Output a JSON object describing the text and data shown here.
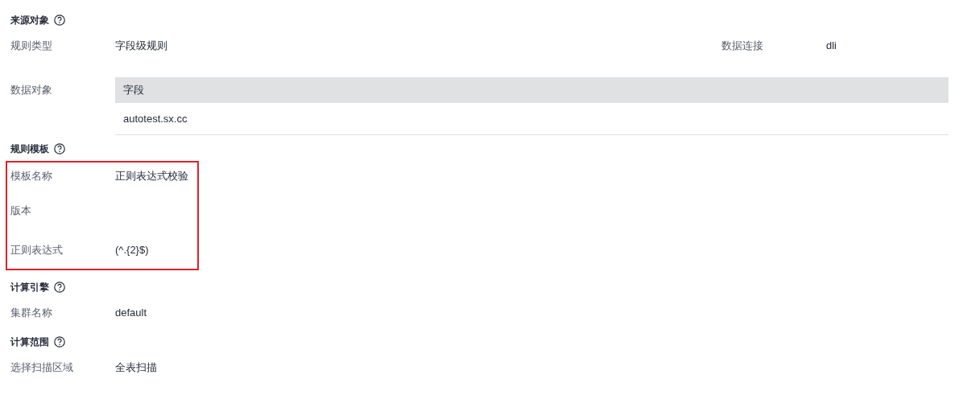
{
  "sections": [
    {
      "title": "来源对象",
      "highlighted": false,
      "rows": [
        {
          "kind": "pair",
          "label": "规则类型",
          "value": "字段级规则",
          "extra_label": "数据连接",
          "extra_value": "dli"
        },
        {
          "kind": "table",
          "label": "数据对象",
          "column": "字段",
          "cells": [
            "autotest.sx.cc"
          ]
        }
      ]
    },
    {
      "title": "规则模板",
      "highlighted": true,
      "rows": [
        {
          "kind": "pair",
          "label": "模板名称",
          "value": "正则表达式校验"
        },
        {
          "kind": "pair",
          "label": "版本"
        },
        {
          "kind": "pair",
          "label": "正则表达式",
          "value": "(^.{2}$)"
        }
      ]
    },
    {
      "title": "计算引擎",
      "highlighted": false,
      "rows": [
        {
          "kind": "pair",
          "label": "集群名称",
          "value": "default"
        }
      ]
    },
    {
      "title": "计算范围",
      "highlighted": false,
      "rows": [
        {
          "kind": "pair",
          "label": "选择扫描区域",
          "value": "全表扫描"
        }
      ]
    }
  ]
}
